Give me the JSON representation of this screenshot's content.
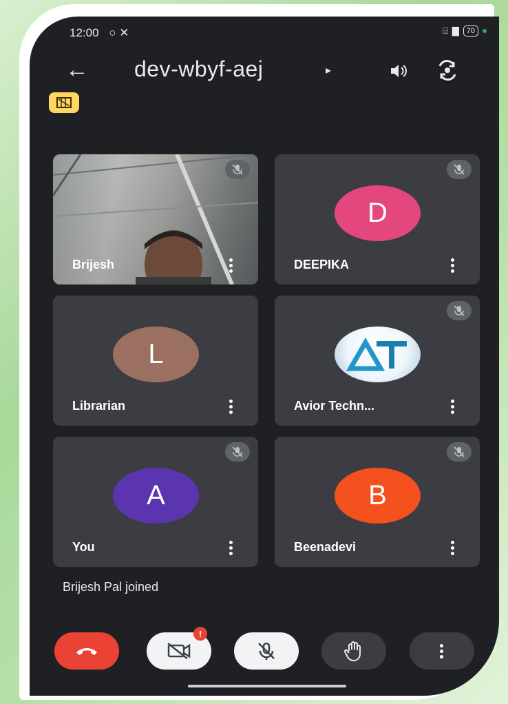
{
  "status_bar": {
    "time": "12:00",
    "battery": "70",
    "signal": "⁡⁡⁡"
  },
  "header": {
    "meeting_code": "dev-wbyf-aej",
    "caret": "▸"
  },
  "participants": [
    {
      "name": "Brijesh",
      "initial": "",
      "avatar_color": "",
      "muted": true,
      "video": true
    },
    {
      "name": "DEEPIKA",
      "initial": "D",
      "avatar_color": "#e4477e",
      "muted": true,
      "video": false
    },
    {
      "name": "Librarian",
      "initial": "L",
      "avatar_color": "#9b7060",
      "muted": false,
      "video": false
    },
    {
      "name": "Avior Techn...",
      "initial": "",
      "avatar_color": "",
      "muted": true,
      "video": false,
      "logo": "AT"
    },
    {
      "name": "You",
      "initial": "A",
      "avatar_color": "#5b35b0",
      "muted": true,
      "video": false
    },
    {
      "name": "Beenadevi",
      "initial": "B",
      "avatar_color": "#f4511e",
      "muted": true,
      "video": false
    }
  ],
  "toast": "Brijesh Pal joined",
  "controls": {
    "end_call_color": "#ea4335",
    "alert_badge": "!"
  }
}
